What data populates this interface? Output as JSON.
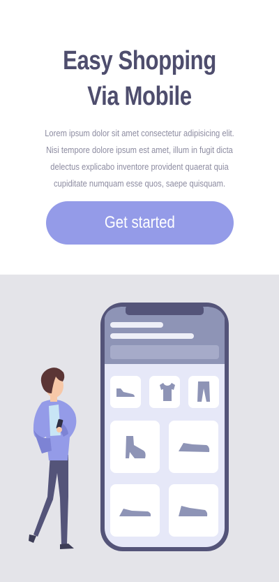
{
  "hero": {
    "title": "Easy Shopping Via Mobile",
    "description": "Lorem ipsum dolor sit amet consectetur adipisicing elit. Nisi tempore dolore ipsum est amet, illum in fugit dicta delectus explicabo inventore provident quaerat quia cupiditate numquam esse quos, saepe quisquam.",
    "cta_label": "Get started"
  },
  "illustration": {
    "colors": {
      "background": "#e4e4e9",
      "phone_frame": "#545479",
      "phone_screen": "#e6e8f8",
      "phone_header": "#8e94b6",
      "product_icon": "#8e94b6",
      "accent": "#949be8"
    },
    "products": [
      "sneaker-icon",
      "tshirt-icon",
      "pants-icon",
      "boot-icon",
      "sneaker-icon",
      "sneaker-icon",
      "sneaker-icon"
    ]
  }
}
